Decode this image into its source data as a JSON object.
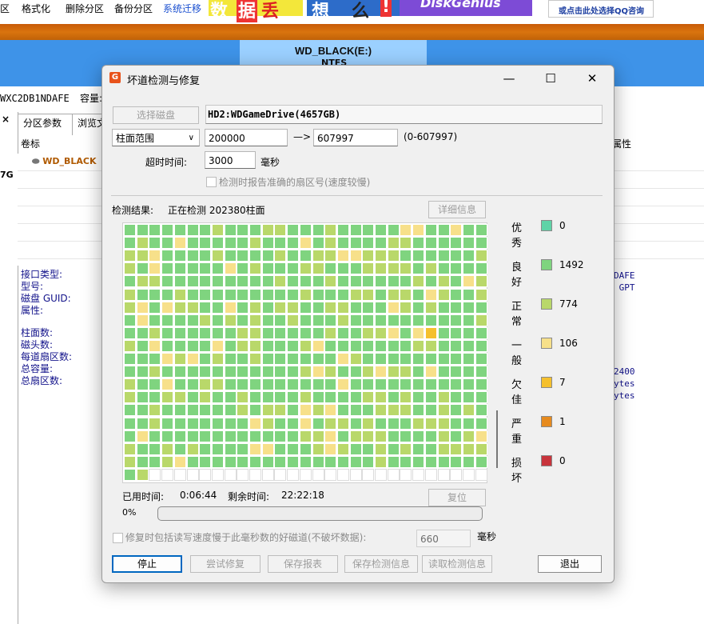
{
  "toolbar": {
    "items": [
      "区",
      "格式化",
      "删除分区",
      "备份分区",
      "系统迁移"
    ],
    "ad_text_1": [
      "数",
      "据",
      "丢"
    ],
    "ad_text_2": [
      "想",
      "么",
      "!"
    ],
    "ad_text_3": "DiskGenius",
    "ad_text_4": "或点击此处选择QQ咨询"
  },
  "partition_bar": {
    "name": "WD_BLACK(E:)",
    "fs": "NTFS"
  },
  "disk_line": {
    "serial": "WXC2DB1NDAFE",
    "capacity_label": "容量:"
  },
  "left": {
    "close": "×",
    "size_fragment": "7G"
  },
  "main": {
    "tabs": [
      "分区参数",
      "浏览文"
    ],
    "col_volume": "卷标",
    "col_attr": "属性",
    "volume_entry": "WD_BLACK",
    "info_labels_1": "接口类型:\n型号:\n磁盘 GUID:\n属性:",
    "info_labels_2": "柱面数:\n磁头数:\n每道扇区数:\n总容量:\n总扇区数:",
    "info_right_1": "DAFE\n GPT",
    "info_right_2": "2400\nytes\nytes"
  },
  "dialog": {
    "title": "坏道检测与修复",
    "window_controls": {
      "minimize": "—",
      "maximize": "☐",
      "close": "✕"
    },
    "select_disk_button": "选择磁盘",
    "drive": "HD2:WDGameDrive(4657GB)",
    "range_select": "柱面范围",
    "range_start": "200000",
    "arrow": "—>",
    "range_end": "607997",
    "range_hint": "(0-607997)",
    "timeout_label": "超时时间:",
    "timeout_value": "3000",
    "timeout_unit": "毫秒",
    "accurate_sector_label": "检测时报告准确的扇区号(速度较慢)",
    "result_label": "检测结果:",
    "result_status": "正在检测 202380柱面",
    "detail_button": "详细信息",
    "elapsed_label": "已用时间:",
    "elapsed": "0:06:44",
    "remaining_label": "剩余时间:",
    "remaining": "22:22:18",
    "reset_button": "复位",
    "progress_text": "0%",
    "progress_value": 0,
    "repair_option_label": "修复时包括读写速度慢于此毫秒数的好磁道(不破坏数据):",
    "repair_ms_value": "660",
    "repair_ms_unit": "毫秒",
    "buttons": {
      "stop": "停止",
      "try_repair": "尝试修复",
      "save_report": "保存报表",
      "save_info": "保存检测信息",
      "load_info": "读取检测信息",
      "exit": "退出"
    },
    "legend": [
      {
        "label": "优秀",
        "color": "#5fd3a7",
        "count": "0"
      },
      {
        "label": "良好",
        "color": "#7fd47f",
        "count": "1492"
      },
      {
        "label": "正常",
        "color": "#b9d86a",
        "count": "774"
      },
      {
        "label": "一般",
        "color": "#f7e08a",
        "count": "106"
      },
      {
        "label": "欠佳",
        "color": "#f5c02d",
        "count": "7"
      },
      {
        "label": "严重",
        "color": "#e68a1e",
        "count": "1"
      },
      {
        "label": "损坏",
        "color": "#c8343c",
        "count": "0"
      }
    ]
  }
}
